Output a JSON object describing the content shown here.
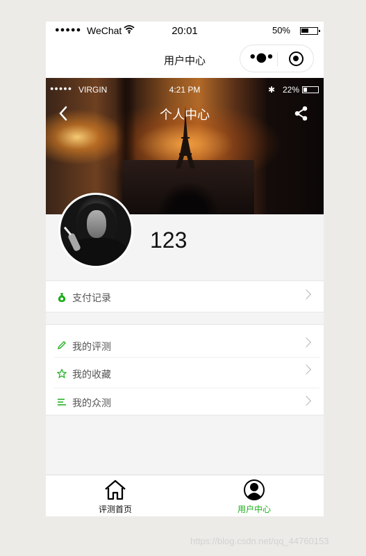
{
  "status_bar": {
    "signal": "●●●●●",
    "carrier": "WeChat",
    "time": "20:01",
    "battery": "50%"
  },
  "nav": {
    "title": "用户中心",
    "more_label": "•●•"
  },
  "banner": {
    "inner_status": {
      "signal": "●●●●●",
      "carrier": "VIRGIN",
      "time": "4:21 PM",
      "battery": "22%"
    },
    "title": "个人中心"
  },
  "profile": {
    "username": "123"
  },
  "menu_groups": [
    {
      "items": [
        {
          "label": "支付记录",
          "icon": "money-bag-icon"
        }
      ]
    },
    {
      "items": [
        {
          "label": "我的评测",
          "icon": "pencil-icon"
        },
        {
          "label": "我的收藏",
          "icon": "star-icon"
        },
        {
          "label": "我的众测",
          "icon": "list-icon"
        }
      ]
    }
  ],
  "tabbar": {
    "tabs": [
      {
        "label": "评测首页",
        "icon": "home-icon",
        "active": false
      },
      {
        "label": "用户中心",
        "icon": "user-icon",
        "active": true
      }
    ]
  },
  "colors": {
    "accent": "#1aad19",
    "background": "#f4f4f4"
  },
  "watermark": "https://blog.csdn.net/qq_44760153"
}
